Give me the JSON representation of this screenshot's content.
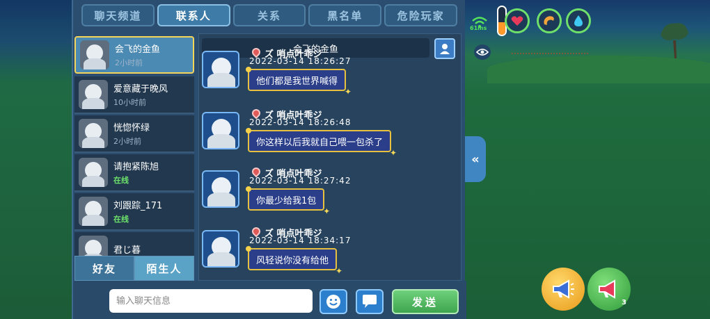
{
  "tabs": [
    {
      "label": "聊天频道",
      "active": false
    },
    {
      "label": "联系人",
      "active": true
    },
    {
      "label": "关系",
      "active": false
    },
    {
      "label": "黑名单",
      "active": false
    },
    {
      "label": "危险玩家",
      "active": false
    }
  ],
  "contacts": [
    {
      "name": "会飞的金鱼",
      "status": "2小时前",
      "online": false,
      "active": true
    },
    {
      "name": "爱意藏于晚风",
      "status": "10小时前",
      "online": false,
      "active": false
    },
    {
      "name": "恍惚怀绿",
      "status": "2小时前",
      "online": false,
      "active": false
    },
    {
      "name": "请抱紧陈旭",
      "status": "在线",
      "online": true,
      "active": false
    },
    {
      "name": "刘跟踪_171",
      "status": "在线",
      "online": true,
      "active": false
    },
    {
      "name": "君じ暮",
      "status": "",
      "online": false,
      "active": false
    }
  ],
  "sub_tabs": {
    "friends": "好友",
    "strangers": "陌生人"
  },
  "chat": {
    "title": "会飞的金鱼",
    "messages": [
      {
        "sender": "ズ 哨点叶乖ジ",
        "time": "2022-03-14  18:26:27",
        "text": "他们都是我世界喊得"
      },
      {
        "sender": "ズ 哨点叶乖ジ",
        "time": "2022-03-14  18:26:48",
        "text": "你这样以后我就自己喂一包杀了"
      },
      {
        "sender": "ズ 哨点叶乖ジ",
        "time": "2022-03-14  18:27:42",
        "text": "你最少给我1包"
      },
      {
        "sender": "ズ 哨点叶乖ジ",
        "time": "2022-03-14  18:34:17",
        "text": "风轻说你没有给他"
      }
    ]
  },
  "input": {
    "placeholder": "输入聊天信息",
    "value": ""
  },
  "buttons": {
    "send": "发送",
    "collapse": "«"
  },
  "hud": {
    "ping": "61ms",
    "stamina_level": 0.45,
    "speaker_count": "3",
    "colors": {
      "accent_green": "#6fe06a",
      "stamina": "#ff9a2a",
      "heart": "#e83a5a",
      "water": "#3fc8f0"
    },
    "icons": [
      "wifi-icon",
      "heart-icon",
      "hunger-icon",
      "water-icon",
      "eye-icon",
      "megaphone-icon",
      "speaker-icon"
    ]
  }
}
